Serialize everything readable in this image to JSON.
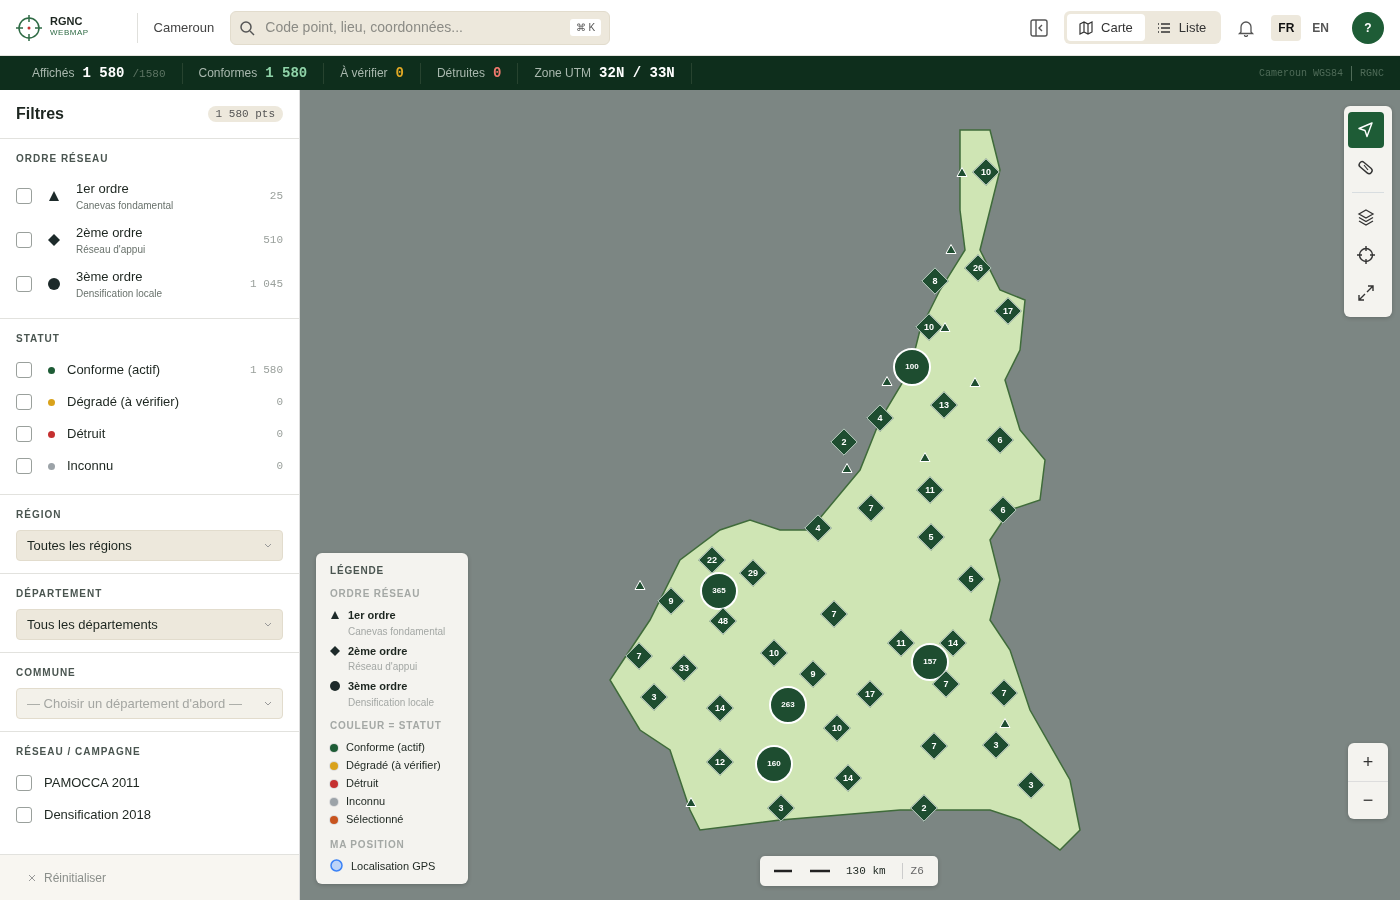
{
  "header": {
    "logo": {
      "title": "RGNC",
      "subtitle": "WEBMAP"
    },
    "country": "Cameroun",
    "search": {
      "placeholder": "Code point, lieu, coordonnées...",
      "shortcut": "⌘ K"
    },
    "views": [
      {
        "label": "Carte",
        "kind": "map",
        "selected": true
      },
      {
        "label": "Liste",
        "kind": "list",
        "selected": false
      }
    ],
    "languages": [
      {
        "label": "FR",
        "selected": true
      },
      {
        "label": "EN",
        "selected": false
      }
    ],
    "help": "?"
  },
  "stats": [
    {
      "label": "Affichés",
      "value": "1 580",
      "total": "/1580",
      "color": "#ffffff"
    },
    {
      "label": "Conformes",
      "value": "1 580",
      "color": "#8fd3a8"
    },
    {
      "label": "À vérifier",
      "value": "0",
      "color": "#e0a825"
    },
    {
      "label": "Détruites",
      "value": "0",
      "color": "#f07a6e"
    },
    {
      "label": "Zone UTM",
      "value": "32N / 33N",
      "color": "#ffffff"
    }
  ],
  "stats_right": [
    "Cameroun WGS84",
    "RGNC"
  ],
  "filters": {
    "title": "Filtres",
    "count": "1 580 pts",
    "order_title": "ORDRE RÉSEAU",
    "orders": [
      {
        "kind": "triangle",
        "label": "1er ordre",
        "sub": "Canevas fondamental",
        "count": "25",
        "checked": false
      },
      {
        "kind": "diamond",
        "label": "2ème ordre",
        "sub": "Réseau d'appui",
        "count": "510",
        "checked": false
      },
      {
        "kind": "circle",
        "label": "3ème ordre",
        "sub": "Densification locale",
        "count": "1 045",
        "checked": false
      }
    ],
    "status_title": "STATUT",
    "statuses": [
      {
        "label": "Conforme (actif)",
        "color": "#1e5c36",
        "count": "1 580",
        "checked": false
      },
      {
        "label": "Dégradé (à vérifier)",
        "color": "#d9a21b",
        "count": "0",
        "checked": false
      },
      {
        "label": "Détruit",
        "color": "#c53030",
        "count": "0",
        "checked": false
      },
      {
        "label": "Inconnu",
        "color": "#9ca3a8",
        "count": "0",
        "checked": false
      }
    ],
    "selects": [
      {
        "title": "RÉGION",
        "value": "Toutes les régions",
        "disabled": false
      },
      {
        "title": "DÉPARTEMENT",
        "value": "Tous les départements",
        "disabled": false
      },
      {
        "title": "COMMUNE",
        "placeholder": "— Choisir un département d'abord —",
        "disabled": true
      }
    ],
    "campaign_title": "RÉSEAU / CAMPAGNE",
    "campaigns": [
      {
        "label": "PAMOCCA 2011",
        "checked": false
      },
      {
        "label": "Densification 2018",
        "checked": false
      }
    ],
    "reset": "Réinitialiser"
  },
  "legend": {
    "title": "LÉGENDE",
    "order_title": "ORDRE RÉSEAU",
    "orders": [
      {
        "kind": "triangle",
        "label": "1er ordre",
        "sub": "Canevas fondamental"
      },
      {
        "kind": "diamond",
        "label": "2ème ordre",
        "sub": "Réseau d'appui"
      },
      {
        "kind": "circle",
        "label": "3ème ordre",
        "sub": "Densification locale"
      }
    ],
    "status_title": "COULEUR = STATUT",
    "statuses": [
      {
        "label": "Conforme (actif)",
        "color": "#1e5c36"
      },
      {
        "label": "Dégradé (à vérifier)",
        "color": "#d9a21b"
      },
      {
        "label": "Détruit",
        "color": "#c53030"
      },
      {
        "label": "Inconnu",
        "color": "#9ca3a8"
      },
      {
        "label": "Sélectionné",
        "color": "#c8541e"
      }
    ],
    "position_title": "MA POSITION",
    "gps": "Localisation GPS"
  },
  "map_tools": [
    {
      "kind": "locate",
      "selected": true
    },
    {
      "kind": "measure",
      "selected": false
    },
    {
      "kind": "layers",
      "selected": false
    },
    {
      "kind": "crosshair",
      "selected": false
    },
    {
      "kind": "expand",
      "selected": false
    }
  ],
  "zoom": [
    "+",
    "−"
  ],
  "scale": {
    "distance": "130 km",
    "zoom": "Z6"
  },
  "markers": [
    {
      "kind": "diamond",
      "count": "10"
    },
    {
      "kind": "diamond",
      "count": "26"
    },
    {
      "kind": "diamond",
      "count": "8"
    },
    {
      "kind": "diamond",
      "count": "17"
    },
    {
      "kind": "diamond",
      "count": "10"
    },
    {
      "kind": "circle",
      "count": "100"
    },
    {
      "kind": "diamond",
      "count": "13"
    },
    {
      "kind": "diamond",
      "count": "4"
    },
    {
      "kind": "diamond",
      "count": "2"
    },
    {
      "kind": "diamond",
      "count": "6"
    },
    {
      "kind": "diamond",
      "count": "11"
    },
    {
      "kind": "diamond",
      "count": "7"
    },
    {
      "kind": "diamond",
      "count": "6"
    },
    {
      "kind": "diamond",
      "count": "5"
    },
    {
      "kind": "diamond",
      "count": "4"
    },
    {
      "kind": "diamond",
      "count": "5"
    },
    {
      "kind": "diamond",
      "count": "22"
    },
    {
      "kind": "circle",
      "count": "365"
    },
    {
      "kind": "diamond",
      "count": "29"
    },
    {
      "kind": "diamond",
      "count": "9"
    },
    {
      "kind": "diamond",
      "count": "48"
    },
    {
      "kind": "diamond",
      "count": "7"
    },
    {
      "kind": "diamond",
      "count": "7"
    },
    {
      "kind": "diamond",
      "count": "33"
    },
    {
      "kind": "diamond",
      "count": "10"
    },
    {
      "kind": "diamond",
      "count": "11"
    },
    {
      "kind": "diamond",
      "count": "14"
    },
    {
      "kind": "circle",
      "count": "157"
    },
    {
      "kind": "diamond",
      "count": "9"
    },
    {
      "kind": "diamond",
      "count": "3"
    },
    {
      "kind": "circle",
      "count": "263"
    },
    {
      "kind": "diamond",
      "count": "17"
    },
    {
      "kind": "diamond",
      "count": "7"
    },
    {
      "kind": "diamond",
      "count": "7"
    },
    {
      "kind": "diamond",
      "count": "14"
    },
    {
      "kind": "diamond",
      "count": "10"
    },
    {
      "kind": "diamond",
      "count": "7"
    },
    {
      "kind": "diamond",
      "count": "3"
    },
    {
      "kind": "diamond",
      "count": "12"
    },
    {
      "kind": "circle",
      "count": "160"
    },
    {
      "kind": "diamond",
      "count": "14"
    },
    {
      "kind": "diamond",
      "count": "3"
    },
    {
      "kind": "diamond",
      "count": "2"
    },
    {
      "kind": "diamond",
      "count": "3"
    },
    {
      "kind": "triangle"
    },
    {
      "kind": "triangle"
    },
    {
      "kind": "triangle"
    },
    {
      "kind": "triangle"
    },
    {
      "kind": "triangle"
    },
    {
      "kind": "triangle"
    },
    {
      "kind": "triangle"
    },
    {
      "kind": "triangle"
    },
    {
      "kind": "triangle"
    },
    {
      "kind": "triangle"
    }
  ]
}
